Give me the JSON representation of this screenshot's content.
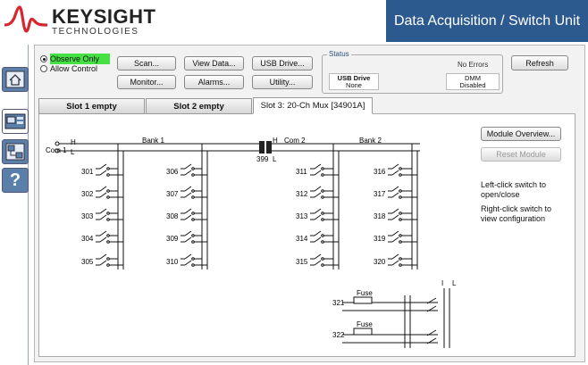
{
  "header": {
    "brand_name": "KEYSIGHT",
    "brand_sub": "TECHNOLOGIES",
    "app_title": "Data Acquisition / Switch Unit"
  },
  "sidebar": {
    "items": [
      {
        "name": "home"
      },
      {
        "name": "instrument"
      },
      {
        "name": "network"
      },
      {
        "name": "help",
        "glyph": "?"
      }
    ]
  },
  "mode": {
    "observe_label": "Observe Only",
    "allow_label": "Allow Control",
    "selected": "observe"
  },
  "toolbar": {
    "scan": "Scan...",
    "view_data": "View Data...",
    "usb_drive": "USB Drive...",
    "monitor": "Monitor...",
    "alarms": "Alarms...",
    "utility": "Utility...",
    "refresh": "Refresh"
  },
  "status": {
    "legend": "Status",
    "errors": "No Errors",
    "usb_label": "USB Drive",
    "usb_value": "None",
    "dmm_label": "DMM",
    "dmm_value": "Disabled"
  },
  "tabs": [
    {
      "label": "Slot 1 empty",
      "active": false
    },
    {
      "label": "Slot 2 empty",
      "active": false
    },
    {
      "label": "Slot 3:  20-Ch Mux [34901A]",
      "active": true
    }
  ],
  "mux": {
    "bank1": "Bank 1",
    "bank2": "Bank 2",
    "com1": "Com 1",
    "com2": "Com 2",
    "h": "H",
    "l": "L",
    "bank_switch": "399",
    "bank1_left": [
      "301",
      "302",
      "303",
      "304",
      "305"
    ],
    "bank1_right": [
      "306",
      "307",
      "308",
      "309",
      "310"
    ],
    "bank2_left": [
      "311",
      "312",
      "313",
      "314",
      "315"
    ],
    "bank2_right": [
      "316",
      "317",
      "318",
      "319",
      "320"
    ],
    "current_channels": [
      "321",
      "322"
    ],
    "fuse": "Fuse",
    "i_label": "I",
    "l_label": "L"
  },
  "side_panel": {
    "module_overview": "Module Overview...",
    "reset_module": "Reset Module",
    "help1": "Left-click switch to open/close",
    "help2": "Right-click switch to view configuration"
  },
  "colors": {
    "title_bar": "#2d5a8e",
    "logo_red": "#d8262e",
    "observe_highlight": "#44e044",
    "sidebar_button": "#5a7fa8"
  }
}
